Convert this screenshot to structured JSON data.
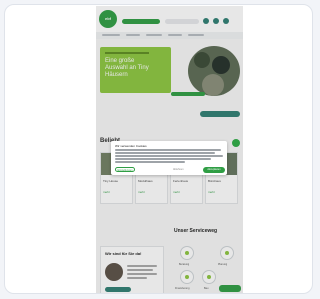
{
  "site": {
    "logo_text": "ebf",
    "hero": {
      "title": "Eine große Auswahl an Tiny Häusern"
    },
    "section_heading": "Beliebt",
    "tiles": [
      {
        "title": "Tiny House",
        "link": "mehr"
      },
      {
        "title": "Modulhaus",
        "link": "mehr"
      },
      {
        "title": "Ferienhaus",
        "link": "mehr"
      },
      {
        "title": "Bürohaus",
        "link": "mehr"
      }
    ],
    "cookie_dialog": {
      "title": "Wir verwenden Cookies",
      "decline_label": "Einstellungen",
      "link_label": "Ablehnen",
      "accept_label": "Akzeptieren"
    },
    "contact_card": {
      "title": "Wir sind für Sie da!"
    },
    "right_heading": "Unser Serviceweg",
    "services": [
      "Beratung",
      "Planung",
      "Finanzierung",
      "Bau"
    ]
  },
  "colors": {
    "brand_green": "#2f9e44",
    "light_green": "#8cc63f",
    "teal": "#2f7f73"
  }
}
